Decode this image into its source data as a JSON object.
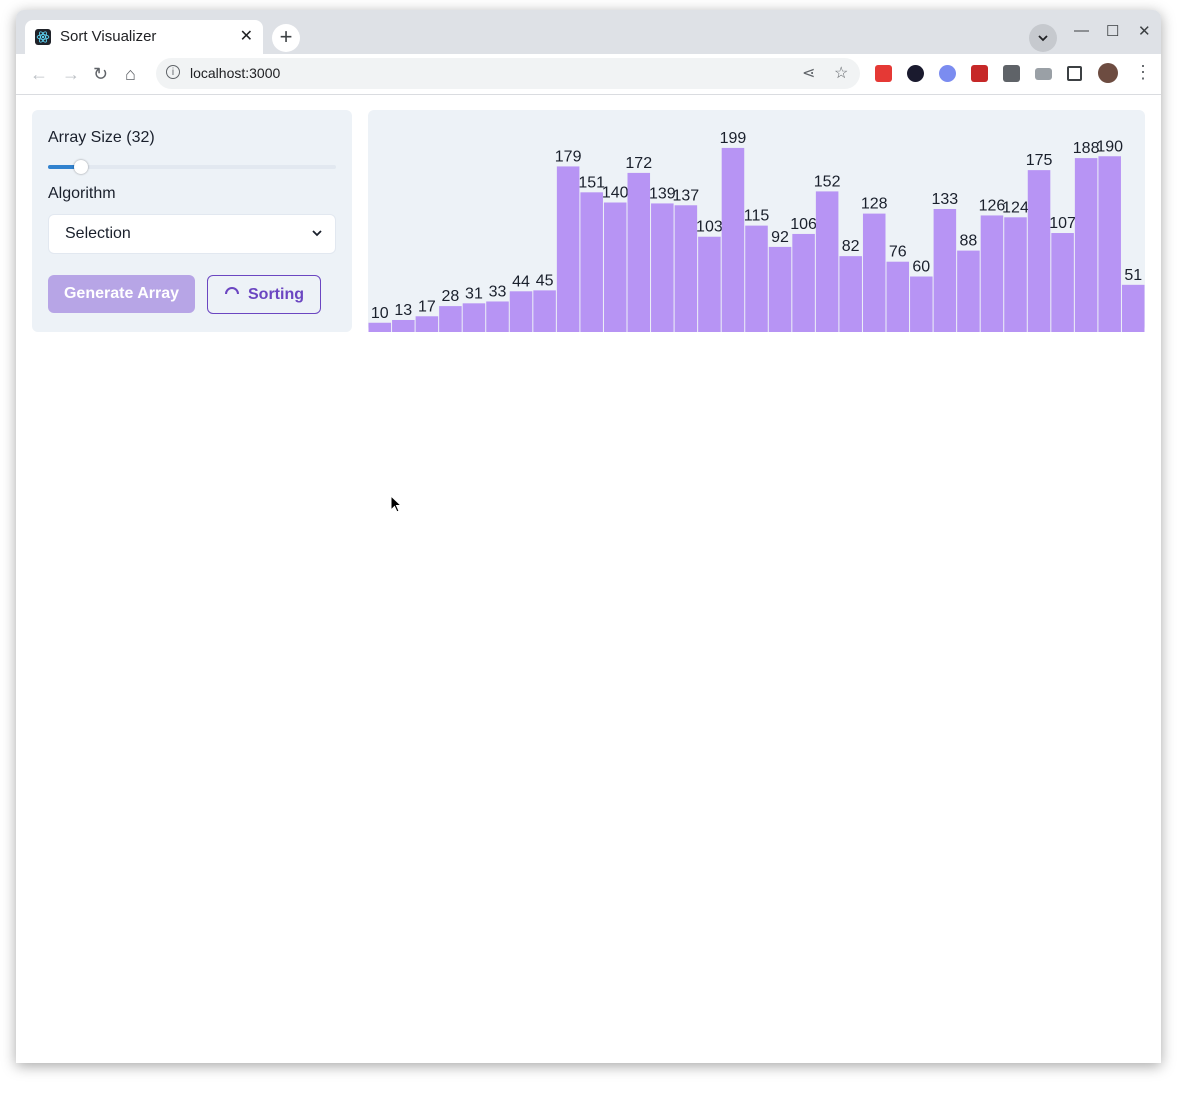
{
  "browser": {
    "tab_title": "Sort Visualizer",
    "url": "localhost:3000",
    "new_tab": "+",
    "close_tab": "✕"
  },
  "controls": {
    "array_size_label": "Array Size (32)",
    "array_size": 32,
    "slider_fraction": 0.115,
    "algorithm_label": "Algorithm",
    "algorithm_selected": "Selection",
    "generate_button": "Generate Array",
    "sorting_button": "Sorting"
  },
  "colors": {
    "bar": "#b794f4",
    "accent": "#6b46c1",
    "slider": "#3182ce",
    "panel": "#edf2f7"
  },
  "chart_data": {
    "type": "bar",
    "values": [
      10,
      13,
      17,
      28,
      31,
      33,
      44,
      45,
      179,
      151,
      140,
      172,
      139,
      137,
      103,
      199,
      115,
      92,
      106,
      152,
      82,
      128,
      76,
      60,
      133,
      88,
      126,
      124,
      175,
      107,
      188,
      190,
      51
    ],
    "ylim": [
      0,
      240
    ],
    "grid": false
  }
}
